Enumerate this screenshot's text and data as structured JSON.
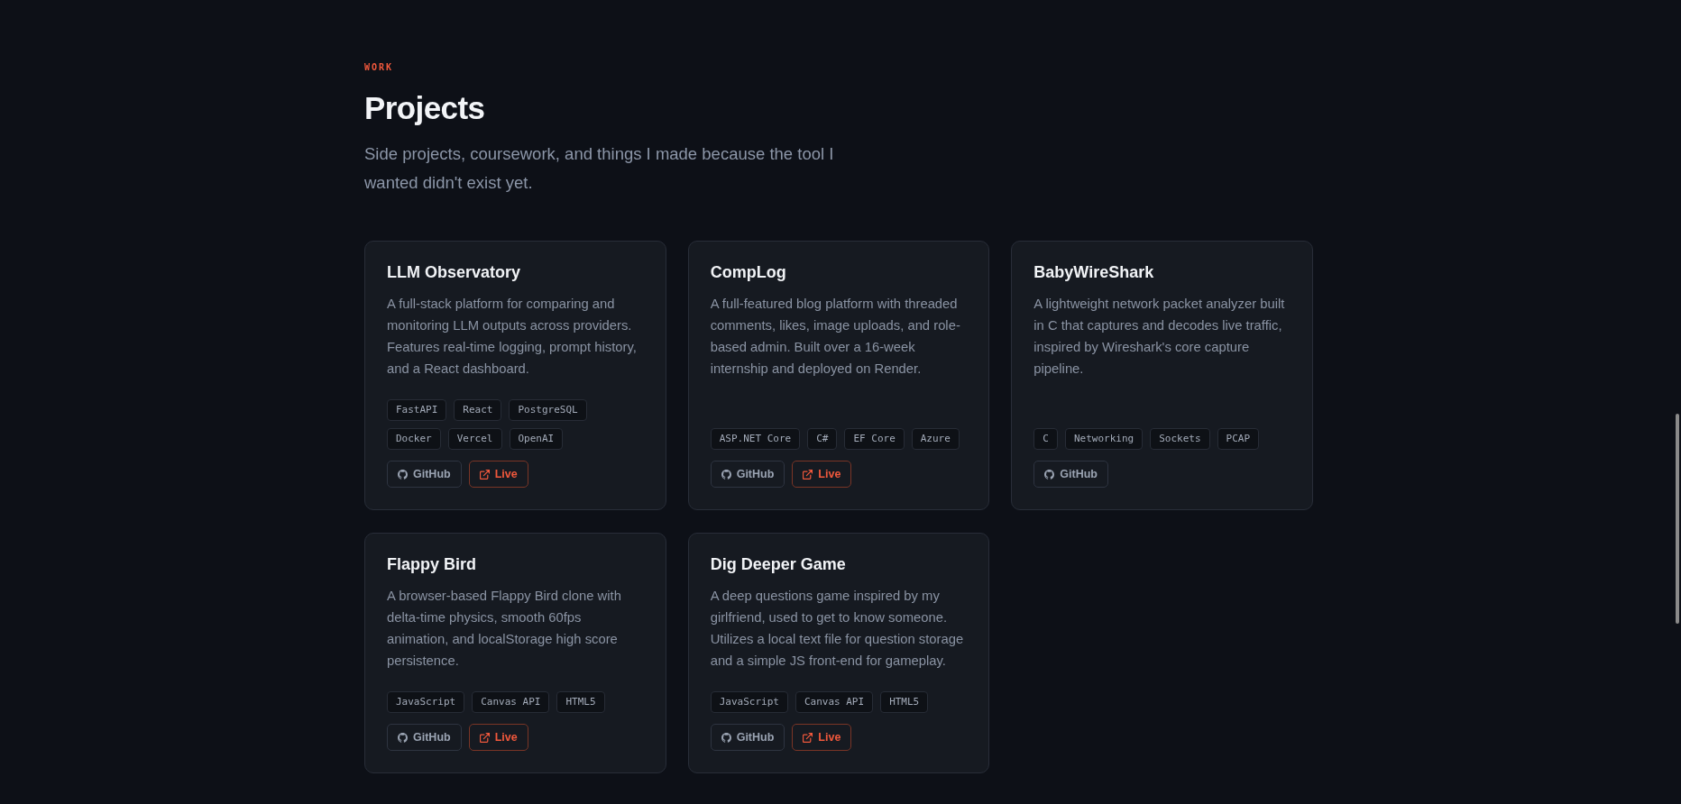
{
  "header": {
    "eyebrow": "WORK",
    "title": "Projects",
    "subtitle": "Side projects, coursework, and things I made because the tool I wanted didn't exist yet."
  },
  "projects": [
    {
      "title": "LLM Observatory",
      "description": "A full-stack platform for comparing and monitoring LLM outputs across providers. Features real-time logging, prompt history, and a React dashboard.",
      "tags": [
        "FastAPI",
        "React",
        "PostgreSQL",
        "Docker",
        "Vercel",
        "OpenAI"
      ],
      "links": [
        {
          "kind": "github",
          "label": "GitHub"
        },
        {
          "kind": "live",
          "label": "Live"
        }
      ]
    },
    {
      "title": "CompLog",
      "description": "A full-featured blog platform with threaded comments, likes, image uploads, and role-based admin. Built over a 16-week internship and deployed on Render.",
      "tags": [
        "ASP.NET Core",
        "C#",
        "EF Core",
        "Azure"
      ],
      "links": [
        {
          "kind": "github",
          "label": "GitHub"
        },
        {
          "kind": "live",
          "label": "Live"
        }
      ]
    },
    {
      "title": "BabyWireShark",
      "description": "A lightweight network packet analyzer built in C that captures and decodes live traffic, inspired by Wireshark's core capture pipeline.",
      "tags": [
        "C",
        "Networking",
        "Sockets",
        "PCAP"
      ],
      "links": [
        {
          "kind": "github",
          "label": "GitHub"
        }
      ]
    },
    {
      "title": "Flappy Bird",
      "description": "A browser-based Flappy Bird clone with delta-time physics, smooth 60fps animation, and localStorage high score persistence.",
      "tags": [
        "JavaScript",
        "Canvas API",
        "HTML5"
      ],
      "links": [
        {
          "kind": "github",
          "label": "GitHub"
        },
        {
          "kind": "live",
          "label": "Live"
        }
      ]
    },
    {
      "title": "Dig Deeper Game",
      "description": "A deep questions game inspired by my girlfriend, used to get to know someone. Utilizes a local text file for question storage and a simple JS front-end for gameplay.",
      "tags": [
        "JavaScript",
        "Canvas API",
        "HTML5"
      ],
      "links": [
        {
          "kind": "github",
          "label": "GitHub"
        },
        {
          "kind": "live",
          "label": "Live"
        }
      ]
    }
  ]
}
